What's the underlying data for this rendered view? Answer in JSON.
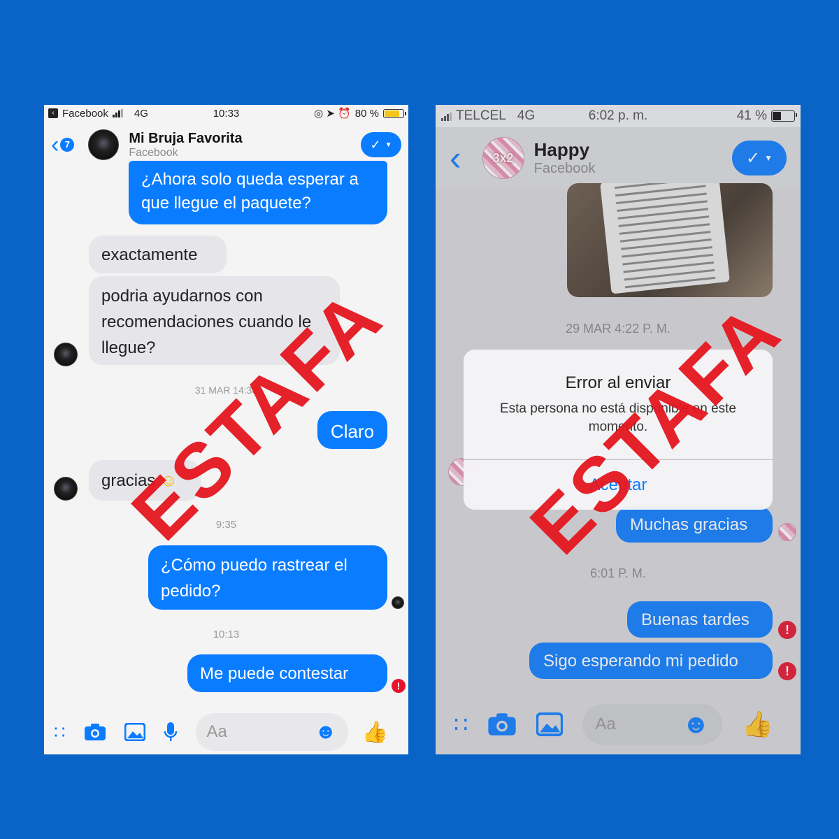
{
  "left": {
    "status": {
      "app": "Facebook",
      "network": "4G",
      "time": "10:33",
      "battery": "80 %",
      "battery_level": 0.8
    },
    "header": {
      "badge": "7",
      "name": "Mi Bruja Favorita",
      "sub": "Facebook"
    },
    "messages": [
      {
        "type": "out",
        "text": "¿Ahora solo queda esperar a que llegue el paquete?"
      },
      {
        "type": "in",
        "text": "exactamente"
      },
      {
        "type": "in",
        "text": "podria ayudarnos con recomendaciones cuando le llegue?"
      },
      {
        "type": "time",
        "text": "31 MAR 14:38"
      },
      {
        "type": "out",
        "text": "Claro"
      },
      {
        "type": "in",
        "text": "gracias"
      },
      {
        "type": "time",
        "text": "9:35"
      },
      {
        "type": "out",
        "text": "¿Cómo puedo rastrear el pedido?"
      },
      {
        "type": "time",
        "text": "10:13"
      },
      {
        "type": "out",
        "text": "Me puede contestar"
      }
    ],
    "composer": {
      "placeholder": "Aa"
    },
    "stamp": "ESTAFA"
  },
  "right": {
    "status": {
      "carrier": "TELCEL",
      "network": "4G",
      "time": "6:02 p. m.",
      "battery": "41 %",
      "battery_level": 0.41
    },
    "header": {
      "name": "Happy",
      "sub": "Facebook",
      "avatar_text": "3x2"
    },
    "messages": [
      {
        "type": "time",
        "text": "29 MAR 4:22 P. M."
      },
      {
        "type": "out",
        "text": "Muchas gracias"
      },
      {
        "type": "time",
        "text": "6:01 P. M."
      },
      {
        "type": "out",
        "text": "Buenas tardes"
      },
      {
        "type": "out",
        "text": "Sigo esperando mi pedido"
      }
    ],
    "dialog": {
      "title": "Error al enviar",
      "message": "Esta persona no está disponible en este momento.",
      "button": "Aceptar"
    },
    "composer": {
      "placeholder": "Aa"
    },
    "stamp": "ESTAFA"
  },
  "colors": {
    "background": "#0A64C8",
    "bubble_out": "#0A7CFF",
    "bubble_in": "#E5E5EA",
    "stamp": "#E5161F",
    "error": "#E5132C"
  }
}
